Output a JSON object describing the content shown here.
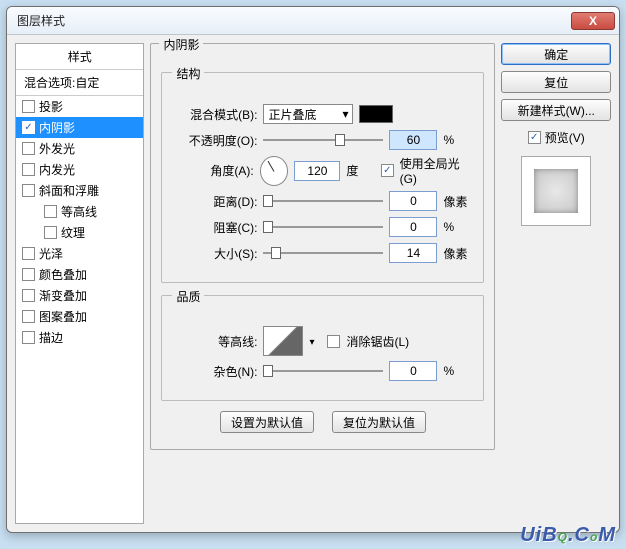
{
  "window": {
    "title": "图层样式",
    "close": "X"
  },
  "styles": {
    "header": "样式",
    "blend_options": "混合选项:自定",
    "items": [
      {
        "label": "投影",
        "checked": false,
        "indent": false
      },
      {
        "label": "内阴影",
        "checked": true,
        "indent": false,
        "selected": true
      },
      {
        "label": "外发光",
        "checked": false,
        "indent": false
      },
      {
        "label": "内发光",
        "checked": false,
        "indent": false
      },
      {
        "label": "斜面和浮雕",
        "checked": false,
        "indent": false
      },
      {
        "label": "等高线",
        "checked": false,
        "indent": true
      },
      {
        "label": "纹理",
        "checked": false,
        "indent": true
      },
      {
        "label": "光泽",
        "checked": false,
        "indent": false
      },
      {
        "label": "颜色叠加",
        "checked": false,
        "indent": false
      },
      {
        "label": "渐变叠加",
        "checked": false,
        "indent": false
      },
      {
        "label": "图案叠加",
        "checked": false,
        "indent": false
      },
      {
        "label": "描边",
        "checked": false,
        "indent": false
      }
    ]
  },
  "panel": {
    "title": "内阴影",
    "structure": {
      "title": "结构",
      "blend_mode_label": "混合模式(B):",
      "blend_mode_value": "正片叠底",
      "opacity_label": "不透明度(O):",
      "opacity_value": "60",
      "percent": "%",
      "angle_label": "角度(A):",
      "angle_value": "120",
      "degree": "度",
      "global_light": "使用全局光(G)",
      "global_light_checked": true,
      "distance_label": "距离(D):",
      "distance_value": "0",
      "px": "像素",
      "choke_label": "阻塞(C):",
      "choke_value": "0",
      "size_label": "大小(S):",
      "size_value": "14"
    },
    "quality": {
      "title": "品质",
      "contour_label": "等高线:",
      "antialias": "消除锯齿(L)",
      "antialias_checked": false,
      "noise_label": "杂色(N):",
      "noise_value": "0"
    },
    "make_default": "设置为默认值",
    "reset_default": "复位为默认值"
  },
  "right": {
    "ok": "确定",
    "reset": "复位",
    "new_style": "新建样式(W)...",
    "preview_label": "预览(V)",
    "preview_checked": true
  },
  "watermark": "UiBQ.CoM"
}
